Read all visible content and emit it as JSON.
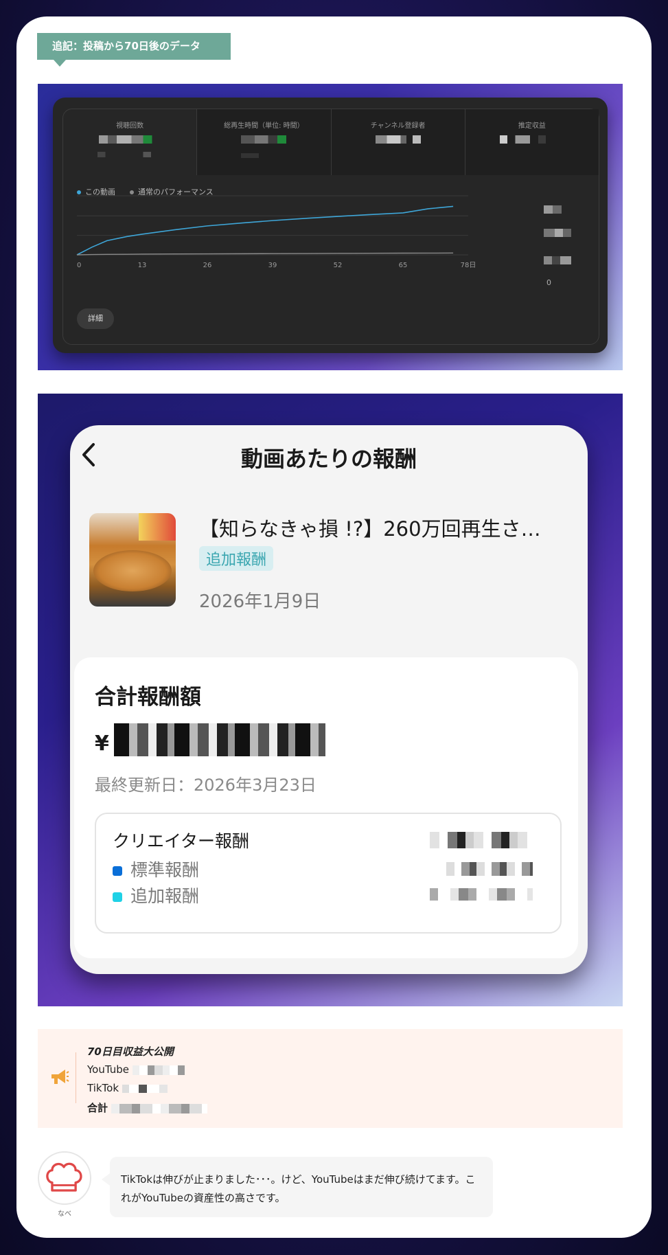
{
  "ribbon": {
    "label": "追記：投稿から70日後のデータ"
  },
  "analytics": {
    "metrics": [
      {
        "label": "視聴回数"
      },
      {
        "label": "総再生時間（単位: 時間）"
      },
      {
        "label": "チャンネル登録者"
      },
      {
        "label": "推定収益"
      }
    ],
    "legend": {
      "this_video": "この動画",
      "typical": "通常のパフォーマンス"
    },
    "y_zero_label": "0",
    "detail_button": "詳細",
    "colors": {
      "series": "#3ea6d8",
      "typical": "#8a8a8a"
    }
  },
  "chart_data": {
    "type": "line",
    "x_tick_labels": [
      "0",
      "13",
      "26",
      "39",
      "52",
      "65",
      "78日"
    ],
    "x": [
      0,
      3,
      6,
      10,
      13,
      20,
      26,
      33,
      39,
      46,
      52,
      58,
      65,
      70,
      75
    ],
    "series": [
      {
        "name": "この動画",
        "values": [
          0.0,
          0.13,
          0.24,
          0.31,
          0.35,
          0.43,
          0.49,
          0.54,
          0.58,
          0.62,
          0.65,
          0.68,
          0.71,
          0.78,
          0.82
        ]
      },
      {
        "name": "通常のパフォーマンス",
        "values": [
          0.0,
          0.005,
          0.008,
          0.01,
          0.012,
          0.015,
          0.017,
          0.019,
          0.021,
          0.023,
          0.025,
          0.027,
          0.029,
          0.03,
          0.031
        ]
      }
    ],
    "xlim": [
      0,
      78
    ],
    "ylim": [
      0,
      1
    ],
    "grid": true,
    "legend": "top-left"
  },
  "phone": {
    "title": "動画あたりの報酬",
    "video_title": "【知らなきゃ損 !?】260万回再生さ…",
    "tag": "追加報酬",
    "date": "2026年1月9日",
    "total_label": "合計報酬額",
    "currency_symbol": "¥",
    "updated": "最終更新日：2026年3月23日",
    "creator_reward": "クリエイター報酬",
    "standard_reward": "標準報酬",
    "additional_reward": "追加報酬",
    "colors": {
      "standard": "#0a6fd8",
      "additional": "#1fd1e6"
    }
  },
  "note": {
    "heading": "70日目収益大公開",
    "youtube": "YouTube",
    "tiktok": "TikTok",
    "total": "合計"
  },
  "chat": {
    "avatar_name": "なべ",
    "message": "TikTokは伸びが止まりました･･･。けど、YouTubeはまだ伸び続けてます。これがYouTubeの資産性の高さです。"
  }
}
